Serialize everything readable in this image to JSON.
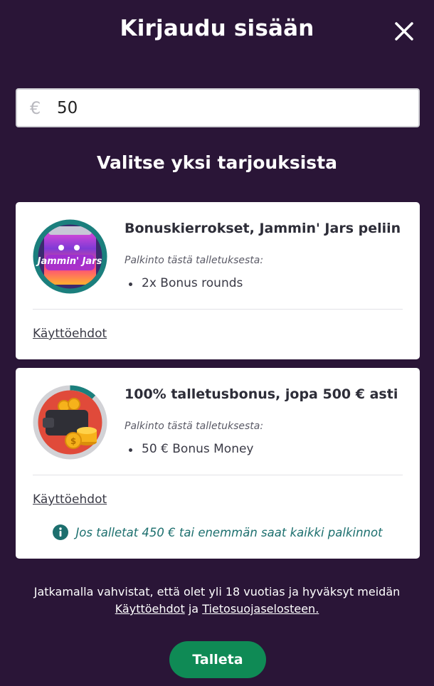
{
  "header": {
    "title": "Kirjaudu sisään"
  },
  "amount": {
    "currency_symbol": "€",
    "value": "50"
  },
  "subtitle": "Valitse yksi tarjouksista",
  "offers": [
    {
      "title": "Bonuskierrokset, Jammin' Jars peliin",
      "reward_caption": "Palkinto tästä talletuksesta:",
      "rewards": [
        "2x Bonus rounds"
      ],
      "terms_label": "Käyttöehdot",
      "image_text": "Jammin' Jars",
      "image_icon": "jammin-jars-game-icon"
    },
    {
      "title": "100% talletusbonus, jopa 500 € asti",
      "reward_caption": "Palkinto tästä talletuksesta:",
      "rewards": [
        "50 € Bonus Money"
      ],
      "terms_label": "Käyttöehdot",
      "image_icon": "wallet-coins-icon",
      "progress": 0.12,
      "info_note": "Jos talletat 450 € tai enemmän saat kaikki palkinnot"
    }
  ],
  "footer": {
    "text_before": "Jatkamalla vahvistat, että olet yli 18 vuotias ja hyväksyt meidän",
    "terms_link": "Käyttöehdot",
    "conjunction": "ja",
    "privacy_link": "Tietosuojaselosteen."
  },
  "deposit_button": {
    "label": "Talleta"
  },
  "colors": {
    "background": "#2a1537",
    "card": "#ffffff",
    "primary_button": "#0f8a55",
    "info_accent": "#1c6f6e",
    "ring_teal": "#1b7f7d"
  }
}
